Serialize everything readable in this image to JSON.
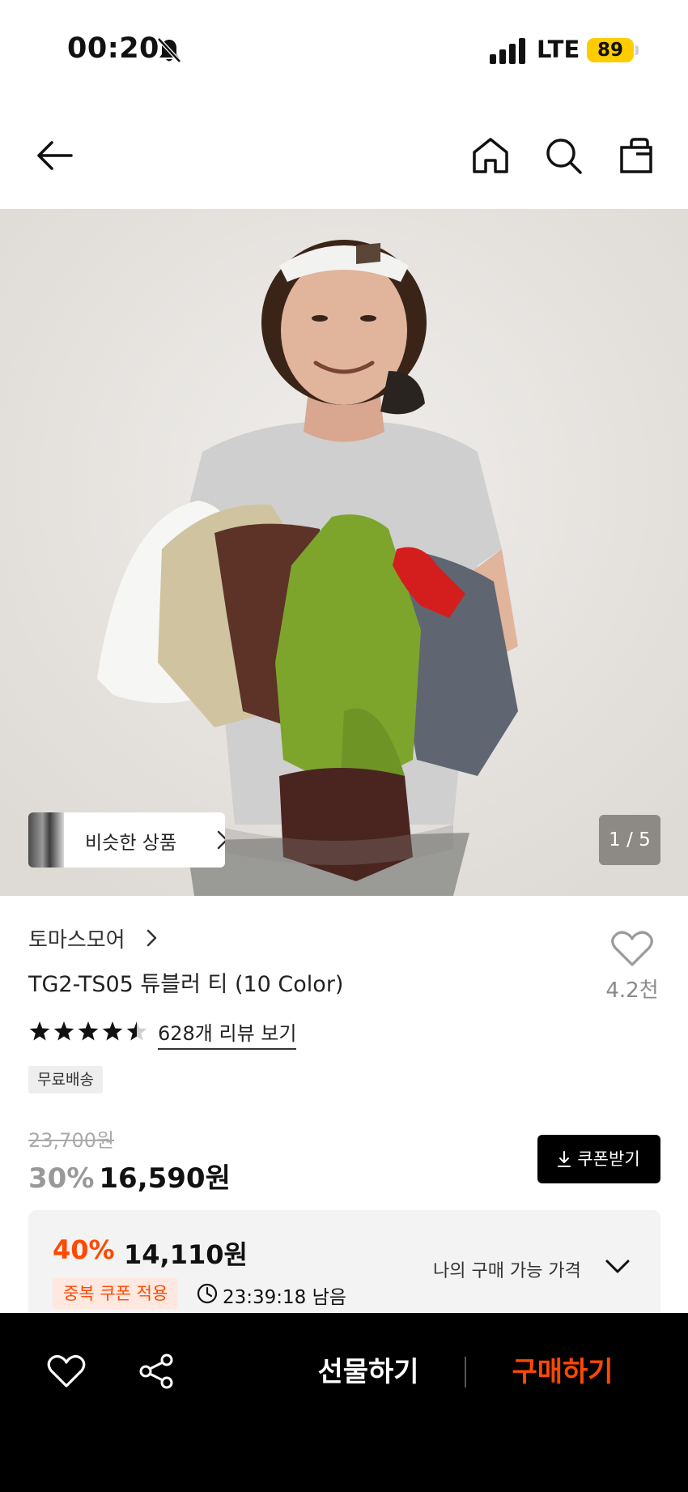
{
  "status_bar": {
    "time": "00:20",
    "network": "LTE",
    "battery": "89"
  },
  "colors": {
    "accent": "#ff4800",
    "battery": "#ffcc00",
    "bottom_bar": "#000000"
  },
  "header": {
    "icons": [
      "back-arrow-icon",
      "home-icon",
      "search-icon",
      "shopping-bag-icon"
    ]
  },
  "gallery": {
    "similar_label": "비슷한 상품",
    "page_indicator": "1 / 5",
    "current_page": 1,
    "total_pages": 5
  },
  "product": {
    "brand": "토마스모어",
    "title": "TG2-TS05 튜블러 티 (10 Color)",
    "likes": "4.2천",
    "rating": 4.5,
    "rating_max": 5,
    "review_link": "628개 리뷰 보기",
    "shipping_badge": "무료배송"
  },
  "price": {
    "original": "23,700원",
    "discount": "30%",
    "sale": "16,590원",
    "coupon_button": "쿠폰받기"
  },
  "coupon_box": {
    "best_discount": "40%",
    "best_price": "14,110원",
    "duplicate_badge": "중복 쿠폰 적용",
    "timer": "23:39:18 남음",
    "available_price_label": "나의 구매 가능 가격"
  },
  "bottom_bar": {
    "gift_label": "선물하기",
    "buy_label": "구매하기"
  }
}
